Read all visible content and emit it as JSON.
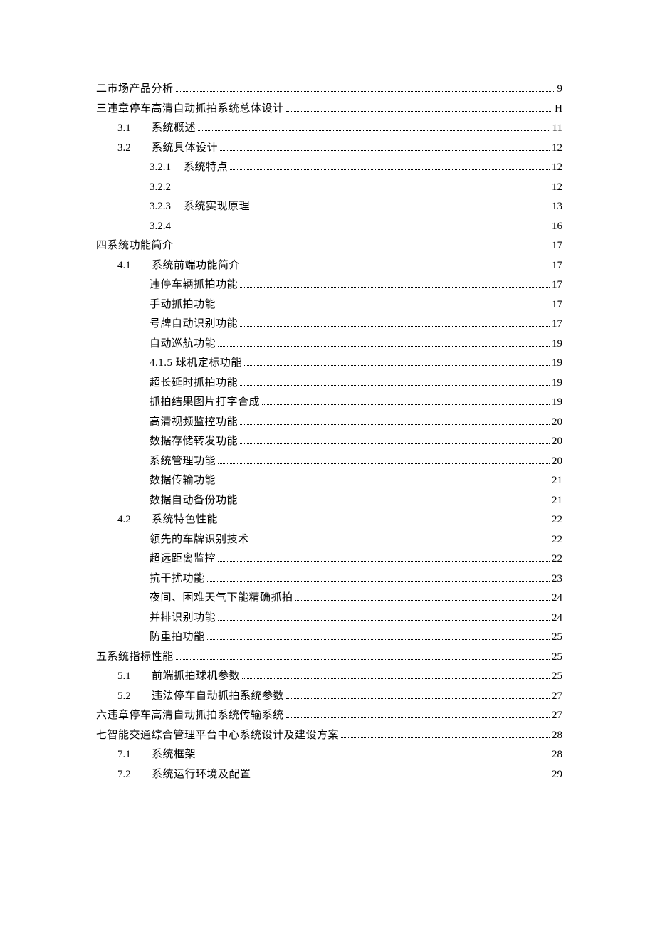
{
  "toc": [
    {
      "level": 1,
      "num": "",
      "text": "二市场产品分析",
      "page": "9",
      "leader": true
    },
    {
      "level": 1,
      "num": "",
      "text": "三违章停车高清自动抓拍系统总体设计",
      "page": "H",
      "leader": true
    },
    {
      "level": 2,
      "num": "3.1",
      "text": "系统概述",
      "page": "11",
      "leader": true
    },
    {
      "level": 2,
      "num": "3.2",
      "text": "系统具体设计",
      "page": "12",
      "leader": true
    },
    {
      "level": 3,
      "num": "3.2.1",
      "text": "系统特点",
      "page": "12",
      "leader": true
    },
    {
      "level": 3,
      "num": "3.2.2",
      "text": "",
      "page": "12",
      "leader": false
    },
    {
      "level": 3,
      "num": "3.2.3",
      "text": "系统实现原理",
      "page": "13",
      "leader": true
    },
    {
      "level": 3,
      "num": "3.2.4",
      "text": "",
      "page": "16",
      "leader": false
    },
    {
      "level": 1,
      "num": "",
      "text": "四系统功能简介",
      "page": "17",
      "leader": true
    },
    {
      "level": 2,
      "num": "4.1",
      "text": "系统前端功能简介",
      "page": "17",
      "leader": true
    },
    {
      "level": 3,
      "num": "",
      "text": "违停车辆抓拍功能",
      "page": "17",
      "leader": true
    },
    {
      "level": 3,
      "num": "",
      "text": "手动抓拍功能",
      "page": "17",
      "leader": true
    },
    {
      "level": 3,
      "num": "",
      "text": "号牌自动识别功能",
      "page": "17",
      "leader": true
    },
    {
      "level": 3,
      "num": "",
      "text": "自动巡航功能",
      "page": "19",
      "leader": true
    },
    {
      "level": 3,
      "num": "",
      "text": "4.1.5 球机定标功能",
      "page": "19",
      "leader": true
    },
    {
      "level": 3,
      "num": "",
      "text": "超长延时抓拍功能",
      "page": "19",
      "leader": true
    },
    {
      "level": 3,
      "num": "",
      "text": "抓拍结果图片打字合成",
      "page": "19",
      "leader": true
    },
    {
      "level": 3,
      "num": "",
      "text": "高清视频监控功能",
      "page": "20",
      "leader": true
    },
    {
      "level": 3,
      "num": "",
      "text": "数据存储转发功能",
      "page": "20",
      "leader": true
    },
    {
      "level": 3,
      "num": "",
      "text": "系统管理功能",
      "page": "20",
      "leader": true
    },
    {
      "level": 3,
      "num": "",
      "text": "数据传输功能",
      "page": "21",
      "leader": true
    },
    {
      "level": 3,
      "num": "",
      "text": "数据自动备份功能",
      "page": "21",
      "leader": true
    },
    {
      "level": 2,
      "num": "4.2",
      "text": "系统特色性能",
      "page": "22",
      "leader": true
    },
    {
      "level": 3,
      "num": "",
      "text": "领先的车牌识别技术",
      "page": "22",
      "leader": true
    },
    {
      "level": 3,
      "num": "",
      "text": "超远距离监控",
      "page": "22",
      "leader": true
    },
    {
      "level": 3,
      "num": "",
      "text": "抗干扰功能",
      "page": "23",
      "leader": true
    },
    {
      "level": 3,
      "num": "",
      "text": "夜间、困难天气下能精确抓拍",
      "page": "24",
      "leader": true
    },
    {
      "level": 3,
      "num": "",
      "text": "并排识别功能",
      "page": "24",
      "leader": true
    },
    {
      "level": 3,
      "num": "",
      "text": "防重拍功能",
      "page": "25",
      "leader": true
    },
    {
      "level": 1,
      "num": "",
      "text": "五系统指标性能",
      "page": "25",
      "leader": true
    },
    {
      "level": 2,
      "num": "5.1",
      "text": "前端抓拍球机参数",
      "page": "25",
      "leader": true
    },
    {
      "level": 2,
      "num": "5.2",
      "text": "违法停车自动抓拍系统参数",
      "page": "27",
      "leader": true
    },
    {
      "level": 1,
      "num": "",
      "text": "六违章停车高清自动抓拍系统传输系统",
      "page": "27",
      "leader": true
    },
    {
      "level": 1,
      "num": "",
      "text": "七智能交通综合管理平台中心系统设计及建设方案",
      "page": "28",
      "leader": true
    },
    {
      "level": 2,
      "num": "7.1",
      "text": "系统框架",
      "page": "28",
      "leader": true
    },
    {
      "level": 2,
      "num": "7.2",
      "text": "系统运行环境及配置",
      "page": "29",
      "leader": true
    }
  ]
}
